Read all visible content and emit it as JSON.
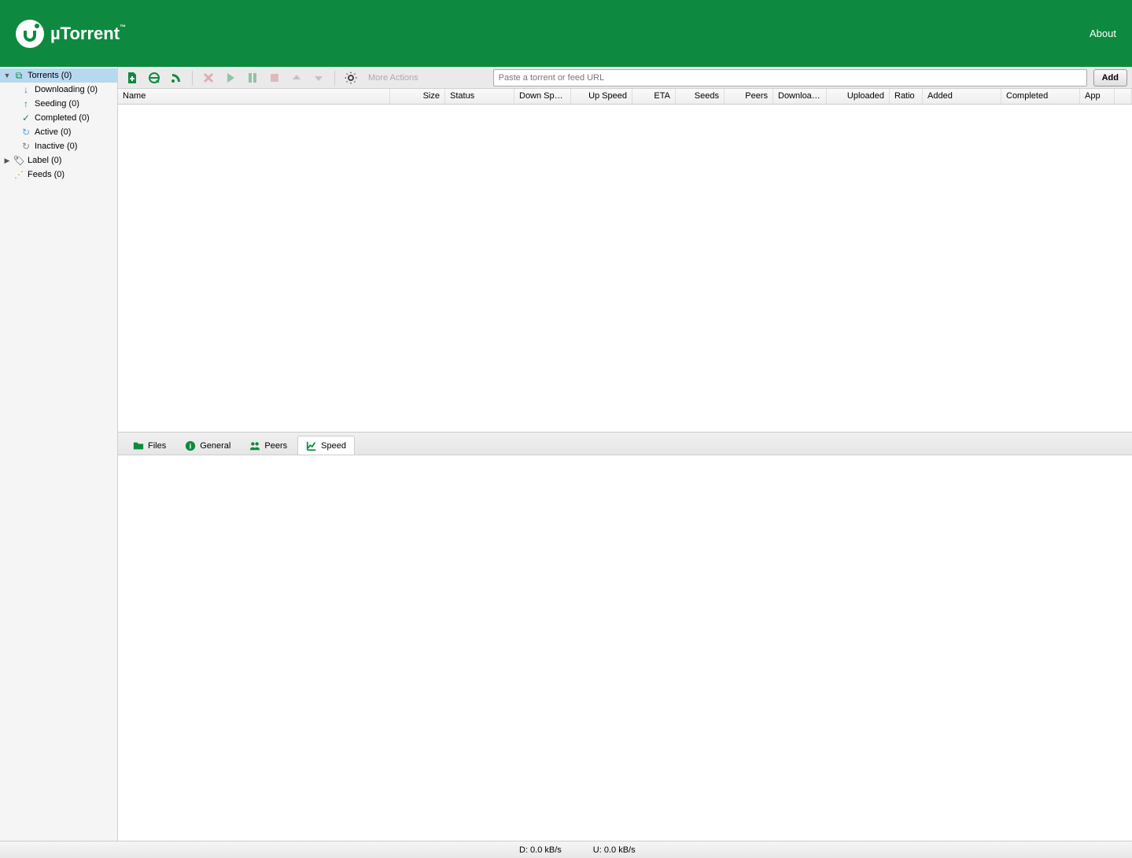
{
  "header": {
    "logo_text": "µTorrent",
    "about": "About"
  },
  "sidebar": {
    "torrents": "Torrents (0)",
    "downloading": "Downloading (0)",
    "seeding": "Seeding (0)",
    "completed": "Completed (0)",
    "active": "Active (0)",
    "inactive": "Inactive (0)",
    "label": "Label (0)",
    "feeds": "Feeds (0)"
  },
  "toolbar": {
    "more_actions": "More Actions",
    "url_placeholder": "Paste a torrent or feed URL",
    "add": "Add"
  },
  "columns": {
    "name": "Name",
    "size": "Size",
    "status": "Status",
    "down_speed": "Down Sp…",
    "up_speed": "Up Speed",
    "eta": "ETA",
    "seeds": "Seeds",
    "peers": "Peers",
    "downloaded": "Downloa…",
    "uploaded": "Uploaded",
    "ratio": "Ratio",
    "added": "Added",
    "completed": "Completed",
    "app": "App"
  },
  "tabs": {
    "files": "Files",
    "general": "General",
    "peers": "Peers",
    "speed": "Speed"
  },
  "status": {
    "down": "D: 0.0 kB/s",
    "up": "U: 0.0 kB/s"
  }
}
